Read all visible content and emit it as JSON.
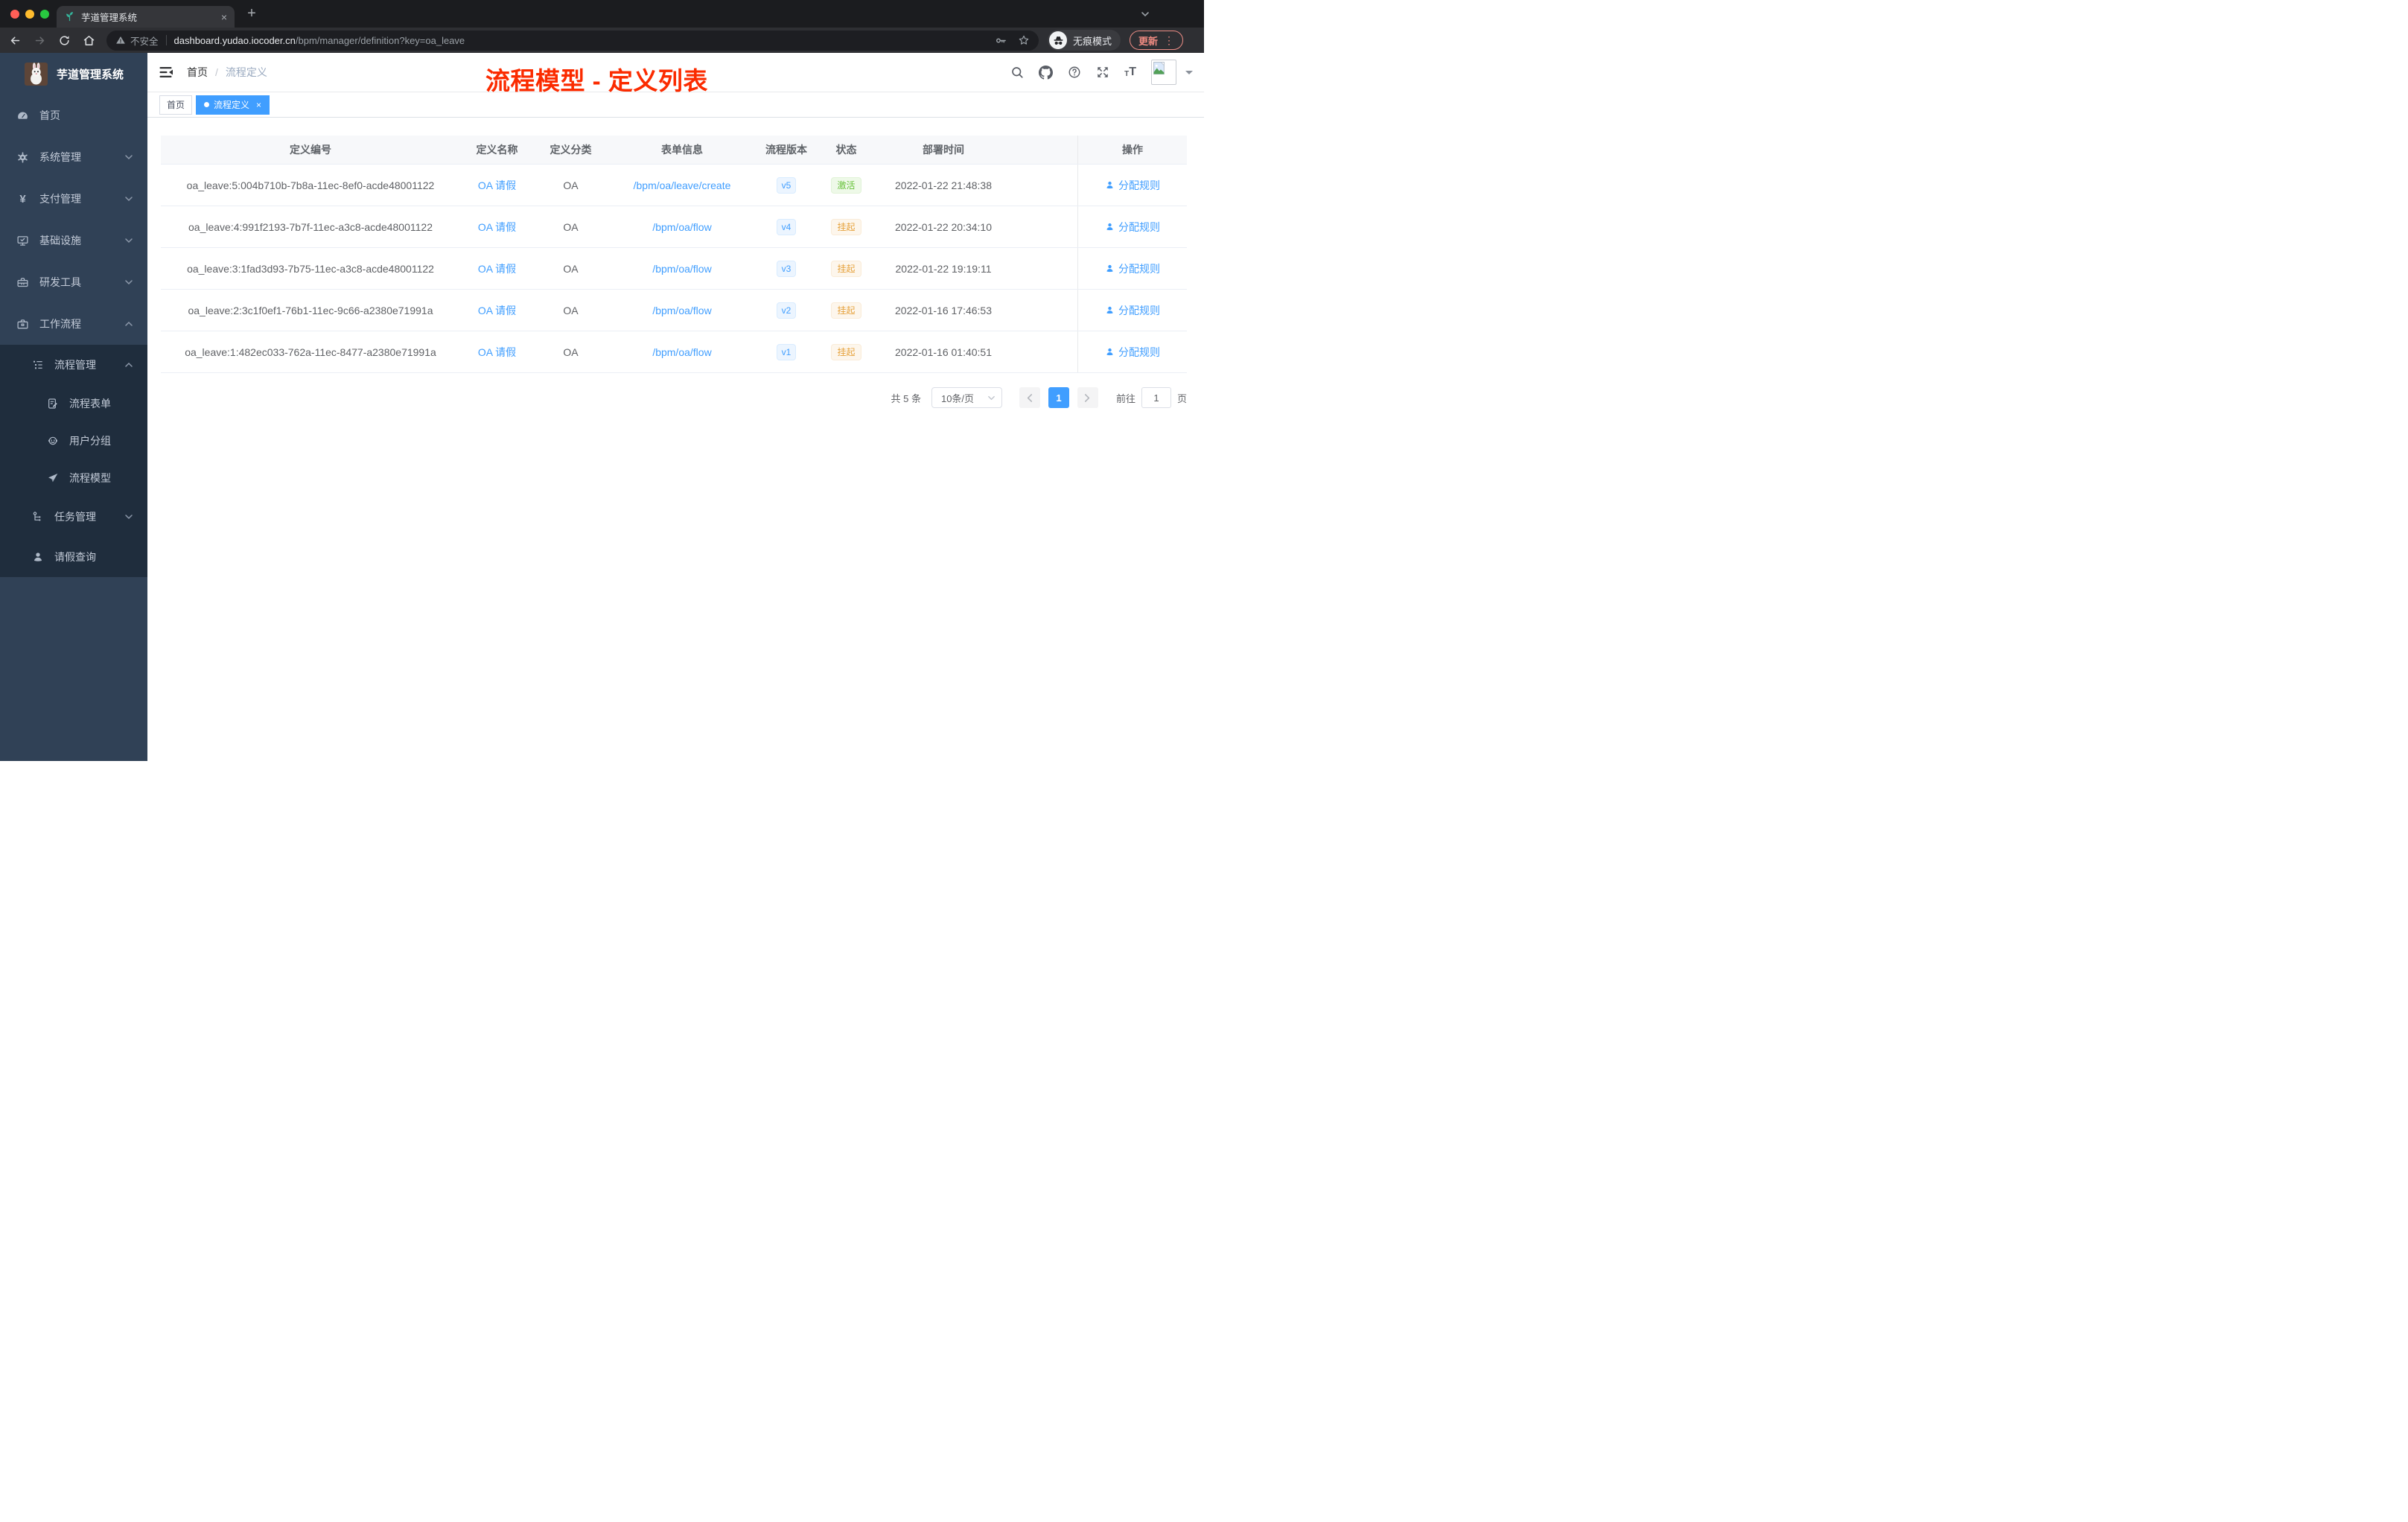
{
  "colors": {
    "accent": "#409eff",
    "sidebar_bg": "#304156",
    "submenu_bg": "#1f2d3d",
    "success": "#67c23a",
    "warning": "#e6a23c",
    "annotation_red": "#fb2b00",
    "update_red": "#f08b82"
  },
  "browser": {
    "tab_title": "芋道管理系统",
    "tab_close": "×",
    "new_tab": "+",
    "security_label": "不安全",
    "url_host": "dashboard.yudao.iocoder.cn",
    "url_path": "/bpm/manager/definition?key=oa_leave",
    "incognito_label": "无痕模式",
    "update_label": "更新",
    "menu_dots": "⋮"
  },
  "sidebar": {
    "logo_title": "芋道管理系统",
    "items": [
      {
        "label": "首页",
        "icon": "dashboard-icon"
      },
      {
        "label": "系统管理",
        "icon": "gear-icon",
        "chevron": "down"
      },
      {
        "label": "支付管理",
        "icon": "yen-icon",
        "chevron": "down"
      },
      {
        "label": "基础设施",
        "icon": "monitor-icon",
        "chevron": "down"
      },
      {
        "label": "研发工具",
        "icon": "toolbox-icon",
        "chevron": "down"
      },
      {
        "label": "工作流程",
        "icon": "briefcase-icon",
        "chevron": "up"
      },
      {
        "label": "流程管理",
        "icon": "tree-list-icon",
        "chevron": "up"
      },
      {
        "label": "流程表单",
        "icon": "form-icon"
      },
      {
        "label": "用户分组",
        "icon": "user-group-icon"
      },
      {
        "label": "流程模型",
        "icon": "paper-plane-icon"
      },
      {
        "label": "任务管理",
        "icon": "org-flow-icon",
        "chevron": "down"
      },
      {
        "label": "请假查询",
        "icon": "person-icon"
      }
    ]
  },
  "navbar": {
    "breadcrumb_home": "首页",
    "breadcrumb_separator": "/",
    "breadcrumb_current": "流程定义"
  },
  "annotation": "流程模型 - 定义列表",
  "tags": {
    "items": [
      {
        "label": "首页"
      },
      {
        "label": "流程定义",
        "close": "×"
      }
    ]
  },
  "table": {
    "columns": [
      "定义编号",
      "定义名称",
      "定义分类",
      "表单信息",
      "流程版本",
      "状态",
      "部署时间",
      "操作"
    ],
    "rows": [
      {
        "id": "oa_leave:5:004b710b-7b8a-11ec-8ef0-acde48001122",
        "name": "OA 请假",
        "category": "OA",
        "form": "/bpm/oa/leave/create",
        "version": "v5",
        "status": "激活",
        "time": "2022-01-22 21:48:38",
        "action": "分配规则"
      },
      {
        "id": "oa_leave:4:991f2193-7b7f-11ec-a3c8-acde48001122",
        "name": "OA 请假",
        "category": "OA",
        "form": "/bpm/oa/flow",
        "version": "v4",
        "status": "挂起",
        "time": "2022-01-22 20:34:10",
        "action": "分配规则"
      },
      {
        "id": "oa_leave:3:1fad3d93-7b75-11ec-a3c8-acde48001122",
        "name": "OA 请假",
        "category": "OA",
        "form": "/bpm/oa/flow",
        "version": "v3",
        "status": "挂起",
        "time": "2022-01-22 19:19:11",
        "action": "分配规则"
      },
      {
        "id": "oa_leave:2:3c1f0ef1-76b1-11ec-9c66-a2380e71991a",
        "name": "OA 请假",
        "category": "OA",
        "form": "/bpm/oa/flow",
        "version": "v2",
        "status": "挂起",
        "time": "2022-01-16 17:46:53",
        "action": "分配规则"
      },
      {
        "id": "oa_leave:1:482ec033-762a-11ec-8477-a2380e71991a",
        "name": "OA 请假",
        "category": "OA",
        "form": "/bpm/oa/flow",
        "version": "v1",
        "status": "挂起",
        "time": "2022-01-16 01:40:51",
        "action": "分配规则"
      }
    ]
  },
  "pagination": {
    "total": "共 5 条",
    "page_size": "10条/页",
    "current_page": "1",
    "goto_label": "前往",
    "goto_value": "1",
    "unit_label": "页"
  }
}
